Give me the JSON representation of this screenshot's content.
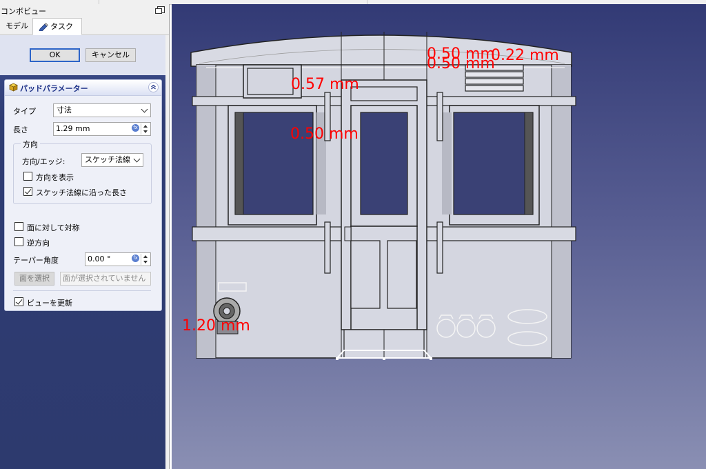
{
  "combo_view": {
    "title": "コンボビュー",
    "tabs": [
      {
        "label": "モデル"
      },
      {
        "label": "タスク"
      }
    ]
  },
  "task": {
    "ok_label": "OK",
    "cancel_label": "キャンセル",
    "panel_title": "パッドパラメーター",
    "type_label": "タイプ",
    "type_value": "寸法",
    "length_label": "長さ",
    "length_value": "1.29 mm",
    "direction_group": "方向",
    "direction_edge_label": "方向/エッジ:",
    "direction_edge_value": "スケッチ法線",
    "show_direction_label": "方向を表示",
    "show_direction_checked": false,
    "along_sketch_normal_label": "スケッチ法線に沿った長さ",
    "along_sketch_normal_checked": true,
    "symmetric_label": "面に対して対称",
    "symmetric_checked": false,
    "reversed_label": "逆方向",
    "reversed_checked": false,
    "taper_label": "テーパー角度",
    "taper_value": "0.00 °",
    "select_face_label": "面を選択",
    "no_face_selected": "面が選択されていません",
    "update_view_label": "ビューを更新",
    "update_view_checked": true
  },
  "viewport": {
    "dimensions": [
      {
        "text": "0.50 mm"
      },
      {
        "text": "0.50 mm"
      },
      {
        "text": "0.22 mm"
      },
      {
        "text": "0.57 mm"
      },
      {
        "text": "0.50 mm"
      },
      {
        "text": "1.20 mm"
      }
    ],
    "colors": {
      "background_top": "#323a75",
      "background_bottom": "#8a8fb3",
      "body_fill": "#d4d6e0",
      "dimension_text": "#ff0000"
    }
  }
}
